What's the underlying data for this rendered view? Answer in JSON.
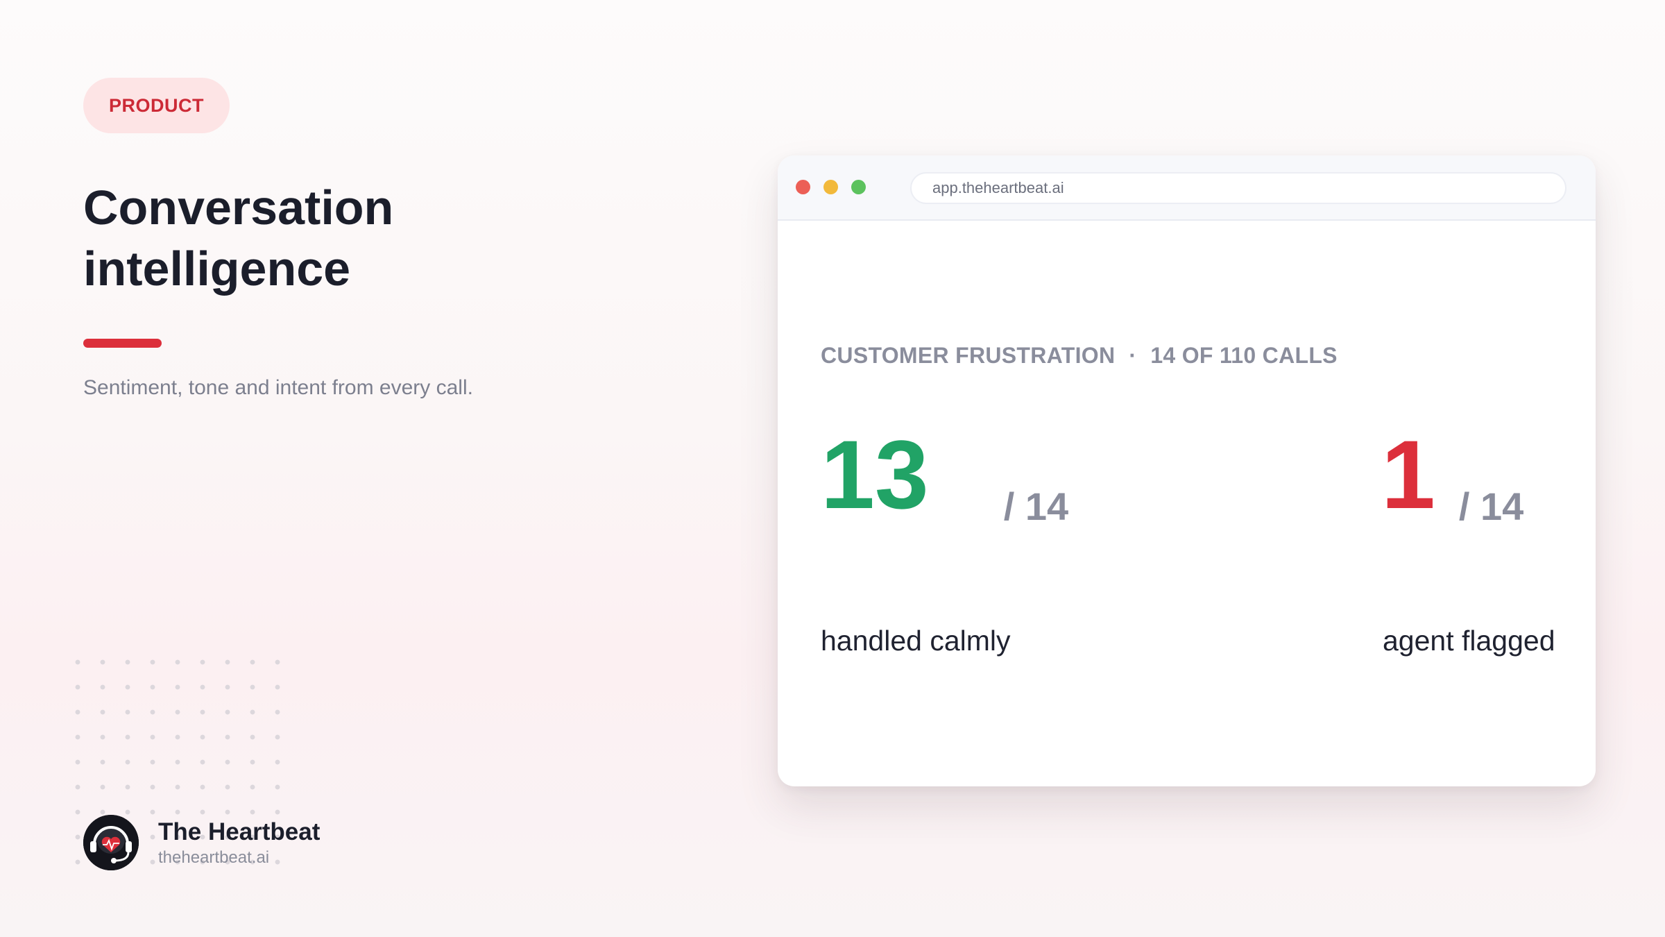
{
  "badge": {
    "label": "PRODUCT"
  },
  "headline": {
    "line1": "Conversation",
    "line2": "intelligence"
  },
  "subtitle": "Sentiment, tone and intent from every call.",
  "brand": {
    "name": "The Heartbeat",
    "url": "theheartbeat.ai",
    "logo_icon": "headset-heart-icon"
  },
  "browser": {
    "url": "app.theheartbeat.ai",
    "section_label": "CUSTOMER FRUSTRATION",
    "separator": "·",
    "section_count": "14 OF 110 CALLS",
    "stats": [
      {
        "value": "13",
        "denominator": "/ 14",
        "caption": "handled calmly",
        "color": "#21a366"
      },
      {
        "value": "1",
        "denominator": "/ 14",
        "caption": "agent flagged",
        "color": "#dc2f3b"
      }
    ]
  },
  "colors": {
    "accent": "#dc2f3b",
    "badge_bg": "#fde4e5",
    "calm": "#21a366",
    "text": "#1b1e2b",
    "muted": "#8a8d9c"
  }
}
